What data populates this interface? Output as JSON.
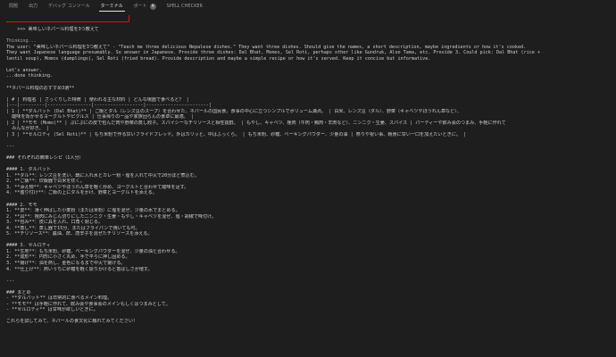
{
  "tabs": [
    {
      "label": "問題"
    },
    {
      "label": "出力"
    },
    {
      "label": "デバッグ コンソール"
    },
    {
      "label": "ターミナル",
      "active": true
    },
    {
      "label": "ポート",
      "badge": "9"
    },
    {
      "label": "SPELL CHECKER"
    }
  ],
  "terminal": {
    "prompt": ">>> 美味しいネパール料理を3つ教えて",
    "lines": [
      "Thinking...",
      "The user: \"美味しいネパール料理を3つ教えて\" - \"Teach me three delicious Nepalese dishes.\" They want three dishes. Should give the names, a short description, maybe ingredients or how it's cooked.",
      "They want Japanese language presumably. So answer in Japanese. Provide three dishes: Dal Bhat, Momos, Sel Roti, perhaps other like Gundruk, Aloo Tama, etc. Provide 3. Could pick: Dal Bhat (rice +",
      "lentil soup), Momos (dumplings), Sel Roti (fried bread). Provide description and maybe a simple recipe or how it's served. Keep it concise but informative.",
      "",
      "Let's answer.",
      "...done thinking.",
      "",
      "**ネパール料理のおすすめ3選**",
      "",
      "| # | 料理名 | ざっくりした特徴 | 使われる主な材料 | どんな場面で食べると？ |",
      "|---|---------|----------------|------------------|-----------------------|",
      "| 1 | **ダルバット (Dal Bhat)** | ご飯とダル（レンズ豆のスープ）を合わせた、ネパールの国民食。食事の中心に立つシンプルでボリューム満点。 | 白米、レンズ豆（ダル）、野菜（キャベツやほうれん草など）、",
      "  酸味を効かせるヨーグルトやピクルス | 仕事帰りの一品や家族団らんの食卓に最適。 |",
      "| 2 | **モモ (Momo)** | ぷにぷにの皮で包んだ肉や野菜の蒸し餃子。スパイシーなチリソースと相性抜群。 | もやし、キャベツ、挽肉（牛肉・鶏肉・羊肉など）、ニンニク・生姜、スパイス | パーティーや飲み会のつまみ、手軽に作れて",
      "  みんなが好き。 |",
      "| 3 | **セルロティ (Sel Roti)** | もち米粉で作る甘いフライドブレッド。外はカリッと、中はふっくら。 | もち米粉、砂糖、ベーキングパウダー、少量の油 | 祭りや祝い事、朝食に甘い一口を加えたいときに。 |",
      "",
      "---",
      "",
      "### それぞれの簡単レシピ（1人分）",
      "",
      "#### 1. ダルバット",
      "1. **ダル**：レンズ豆を洗い、鍋に入れ水とカレー粉・塩を入れて中火で20分ほど煮込む。",
      "2. **ご飯**：炊飯器で白米を炊く。",
      "3. **添え物**：キャベツやほうれん草を軽く炒め、ヨーグルトと合わせて酸味を足す。",
      "4. **盛り付け**：ご飯の上にダルをかけ、野菜とヨーグルトを添える。",
      "",
      "#### 2. モモ",
      "1. **皮**：薄く伸ばした小麦粉（または米粉）に塩を混ぜ、少量の水でまとめる。",
      "2. **具**：挽肉にみじん切りにしたニンニク・生姜・もやし・キャベツを混ぜ、塩・胡椒で味付け。",
      "3. **包み**：皮に具を入れ、口角く閉じる。",
      "4. **蒸し**：蒸し器で15分、またはフライパンで焼いても可。",
      "5. **チリソース**：醤油、酢、唐辛子を混ぜたチリソースを添える。",
      "",
      "#### 3. セルロティ",
      "1. **生地**：もち米粉、砂糖、ベーキングパウダーを混ぜ、少量の油と合わせる。",
      "2. **成形**：円形に小さく丸め、手で平らに押し固める。",
      "3. **揚げ**：油を熱し、金色になるまで中火で揚げる。",
      "4. **仕上げ**：熱いうちに砂糖を軽く振りかけると香ばしさが増す。",
      "",
      "---",
      "",
      "### まとめ",
      "- **ダルバット** は日常的に食べるメイン料理。",
      "- **モモ** は手軽に作れて、飲み会や食事会のメインもしくはつまみとして。",
      "- **セルロティ** は甘味が欲しいときに。",
      "",
      "これらを試してみて、ネパールの食文化に触れてみてください！"
    ]
  },
  "colors": {
    "background": "#1e1e1e",
    "text": "#cccccc",
    "prompt_highlight_border": "#e51400",
    "active_tab": "#e7e7e7",
    "inactive_tab": "#9d9d9d"
  }
}
